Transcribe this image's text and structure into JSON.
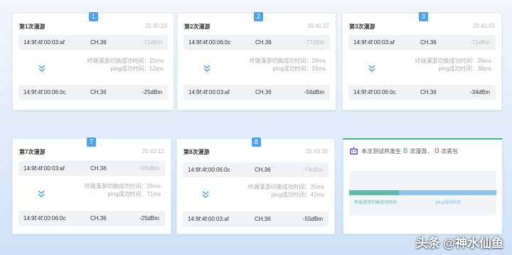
{
  "cards": [
    {
      "badge": "1",
      "title": "第1次漫游",
      "time": "20:40:19",
      "from": {
        "mac": "14:9f:4f:00:03:af",
        "ch": "CH.36",
        "dbm": "-71dBm"
      },
      "stat1": "终端漫游切换成功时间：25ms",
      "stat2": "ping成功时间：52ms",
      "to": {
        "mac": "14:9f:4f:00:06:0c",
        "ch": "CH.36",
        "dbm": "-25dBm"
      }
    },
    {
      "badge": "2",
      "title": "第2次漫游",
      "time": "20:40:37",
      "from": {
        "mac": "14:9f:4f:00:06:0c",
        "ch": "CH.36",
        "dbm": "-77dBm"
      },
      "stat1": "终端漫游切换成功时间：26ms",
      "stat2": "ping成功时间：33ms",
      "to": {
        "mac": "14:9f:4f:00:03:af",
        "ch": "CH.36",
        "dbm": "-56dBm"
      }
    },
    {
      "badge": "3",
      "title": "第3次漫游",
      "time": "20:41:03",
      "from": {
        "mac": "14:9f:4f:00:03:af",
        "ch": "CH.36",
        "dbm": "-71dBm"
      },
      "stat1": "终端漫游切换成功时间：26ms",
      "stat2": "ping成功时间：38ms",
      "to": {
        "mac": "14:9f:4f:00:06:0c",
        "ch": "CH.36",
        "dbm": "-34dBm"
      }
    },
    {
      "badge": "7",
      "title": "第7次漫游",
      "time": "20:43:12",
      "from": {
        "mac": "14:9f:4f:00:03:af",
        "ch": "CH.36",
        "dbm": "-68dBm"
      },
      "stat1": "终端漫游切换成功时间：26ms",
      "stat2": "ping成功时间：71ms",
      "to": {
        "mac": "14:9f:4f:00:06:0c",
        "ch": "CH.36",
        "dbm": "-25dBm"
      }
    },
    {
      "badge": "8",
      "title": "第8次漫游",
      "time": "20:43:30",
      "from": {
        "mac": "14:9f:4f:00:06:0c",
        "ch": "CH.36",
        "dbm": "-74dBm"
      },
      "stat1": "终端漫游切换成功时间：25ms",
      "stat2": "ping成功时间：42ms",
      "to": {
        "mac": "14:9f:4f:00:03:af",
        "ch": "CH.36",
        "dbm": "-55dBm"
      }
    }
  ],
  "summary": {
    "prefix": "本次测试共发生",
    "roam_count": "8",
    "middle": "次漫游，",
    "drop_count": "0",
    "suffix": "次丢包",
    "roam_label": "终端漫游切换成功时间",
    "ping_label": "ping成功时间",
    "roam_share": 0.34,
    "colors": {
      "roam": "#5dbcab",
      "ping": "#8cc4ee",
      "roam_count": "#3fae6c",
      "drop_count": "#e8423a"
    }
  },
  "watermark": "头条 @神水仙鱼"
}
